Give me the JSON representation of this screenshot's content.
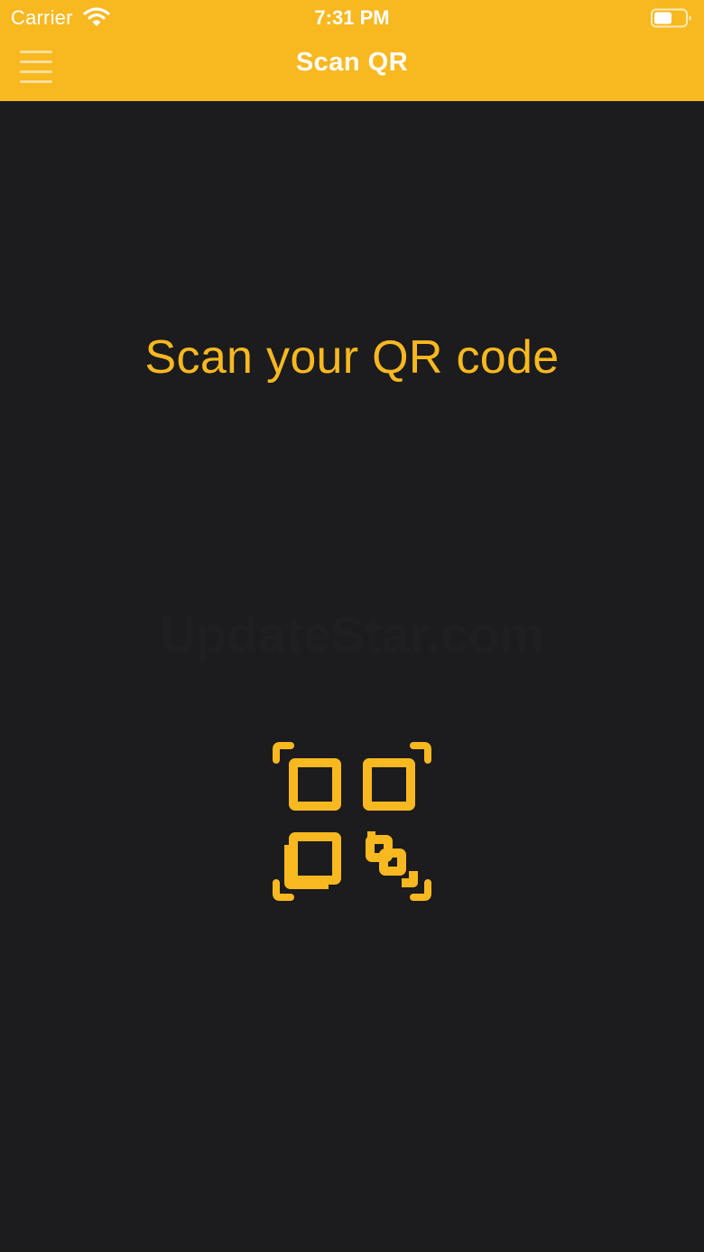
{
  "status_bar": {
    "carrier": "Carrier",
    "time": "7:31 PM",
    "wifi_icon": "wifi-icon",
    "battery_icon": "battery-icon"
  },
  "nav": {
    "title": "Scan QR",
    "menu_icon": "hamburger-menu-icon"
  },
  "main": {
    "prompt": "Scan your QR code",
    "watermark": "UpdateStar.com",
    "scan_icon": "qr-scan-icon"
  },
  "colors": {
    "accent": "#f8b820",
    "background": "#1c1c1e",
    "header_text": "#ffffff"
  }
}
